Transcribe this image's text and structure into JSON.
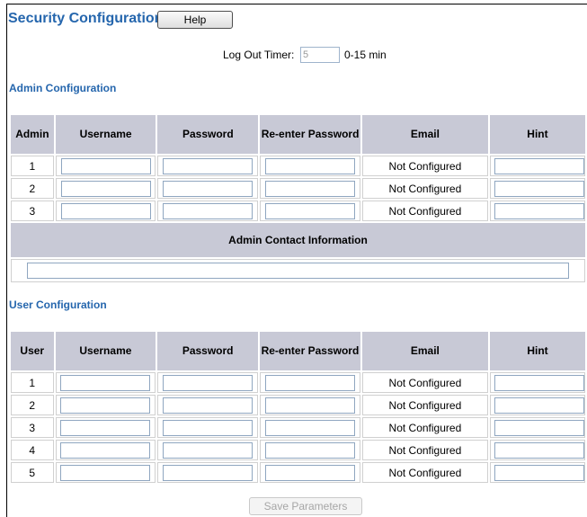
{
  "page": {
    "title": "Security Configuration",
    "help_label": "Help"
  },
  "logout": {
    "label": "Log Out Timer:",
    "value": "5",
    "range": "0-15 min"
  },
  "admin": {
    "heading": "Admin Configuration",
    "columns": [
      "Admin",
      "Username",
      "Password",
      "Re-enter Password",
      "Email",
      "Hint"
    ],
    "rows": [
      {
        "id": "1",
        "email": "Not Configured"
      },
      {
        "id": "2",
        "email": "Not Configured"
      },
      {
        "id": "3",
        "email": "Not Configured"
      }
    ],
    "contact_heading": "Admin Contact Information",
    "contact_value": ""
  },
  "user": {
    "heading": "User Configuration",
    "columns": [
      "User",
      "Username",
      "Password",
      "Re-enter Password",
      "Email",
      "Hint"
    ],
    "rows": [
      {
        "id": "1",
        "email": "Not Configured"
      },
      {
        "id": "2",
        "email": "Not Configured"
      },
      {
        "id": "3",
        "email": "Not Configured"
      },
      {
        "id": "4",
        "email": "Not Configured"
      },
      {
        "id": "5",
        "email": "Not Configured"
      }
    ]
  },
  "actions": {
    "save_label": "Save Parameters"
  }
}
